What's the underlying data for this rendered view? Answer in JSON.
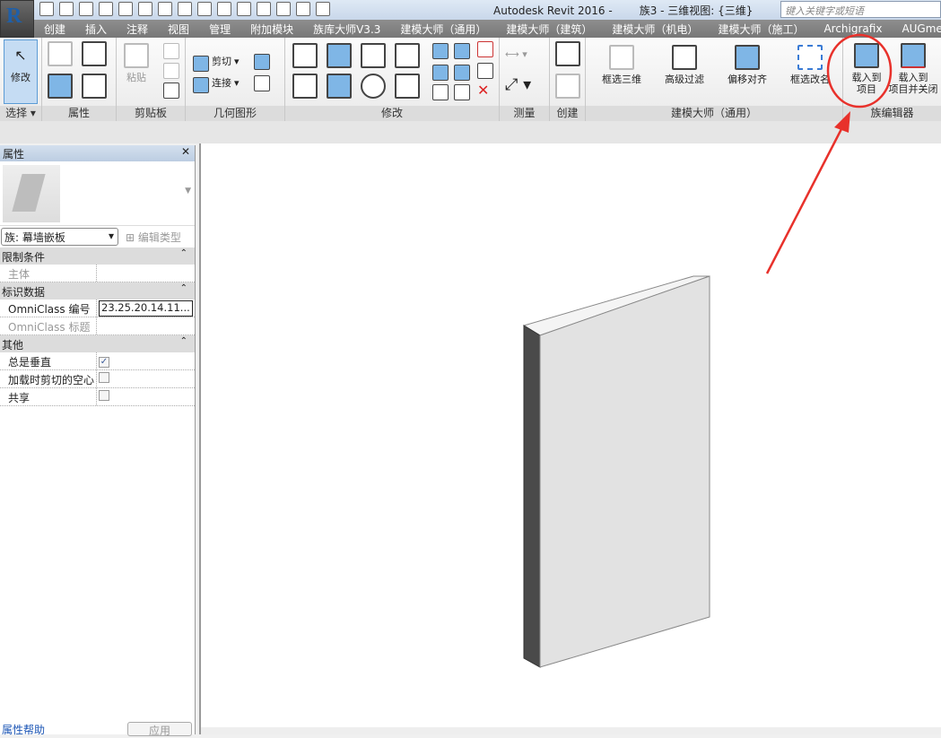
{
  "titlebar": {
    "app": "Autodesk Revit 2016 -",
    "doc": "族3 - 三维视图: {三维}",
    "search_placeholder": "键入关键字或短语",
    "app_button": "R"
  },
  "tabs": [
    "创建",
    "插入",
    "注释",
    "视图",
    "管理",
    "附加模块",
    "族库大师V3.3",
    "建模大师（通用）",
    "建模大师（建筑）",
    "建模大师（机电）",
    "建模大师（施工）",
    "Archigrafix",
    "AUGmentect"
  ],
  "ribbon": {
    "panels": [
      "选择 ▾",
      "属性",
      "剪贴板",
      "几何图形",
      "修改",
      "测量",
      "创建",
      "建模大师（通用）",
      "族编辑器"
    ],
    "modify": "修改",
    "paste": "粘贴",
    "cut": "剪切",
    "join": "连接",
    "tools": [
      "框选三维",
      "高级过滤",
      "偏移对齐",
      "框选改名"
    ],
    "load_project": [
      "载入到",
      "项目"
    ],
    "load_close": [
      "载入到",
      "项目并关闭"
    ]
  },
  "properties": {
    "title": "属性",
    "close": "✕",
    "type_selector": "族: 幕墙嵌板",
    "edit_type": "编辑类型",
    "groups": [
      {
        "name": "限制条件",
        "rows": [
          {
            "key": "主体",
            "value": "",
            "dim": true
          }
        ]
      },
      {
        "name": "标识数据",
        "rows": [
          {
            "key": "OmniClass 编号",
            "value": "23.25.20.14.11..."
          },
          {
            "key": "OmniClass 标题",
            "value": "",
            "dim": true
          }
        ]
      },
      {
        "name": "其他",
        "rows": [
          {
            "key": "总是垂直",
            "checked": true
          },
          {
            "key": "加载时剪切的空心",
            "checked": false
          },
          {
            "key": "共享",
            "checked": false
          }
        ]
      }
    ],
    "help_link": "属性帮助",
    "apply": "应用"
  },
  "annotation": {
    "color": "#e8312b"
  },
  "panel_color": {
    "front": "#e2e2e2",
    "side": "#4a4a4a",
    "top": "#f4f4f4"
  }
}
